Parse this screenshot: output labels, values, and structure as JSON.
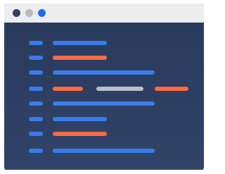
{
  "window": {
    "titlebar_color": "#ededee",
    "editor_background": "#2b3b5e",
    "traffic_lights": [
      {
        "name": "window-dot-dark-icon",
        "color": "#2f3e5c"
      },
      {
        "name": "window-dot-gray-icon",
        "color": "#b7bac0"
      },
      {
        "name": "window-dot-blue-icon",
        "color": "#1a6ef2"
      }
    ]
  },
  "palette": {
    "blue": "#3a7bea",
    "orange": "#ff6a45",
    "gray": "#b8bfc8"
  },
  "code_lines": [
    {
      "segments": [
        "blue",
        "blue"
      ]
    },
    {
      "segments": [
        "blue",
        "orange"
      ]
    },
    {
      "segments": [
        "blue",
        "blue"
      ]
    },
    {
      "segments": [
        "blue",
        "orange",
        "gray",
        "orange"
      ]
    },
    {
      "segments": [
        "blue",
        "blue"
      ]
    },
    {
      "segments": [
        "blue",
        "blue"
      ]
    },
    {
      "segments": [
        "blue",
        "orange"
      ]
    },
    {
      "segments": [
        "blue",
        "blue"
      ]
    }
  ]
}
